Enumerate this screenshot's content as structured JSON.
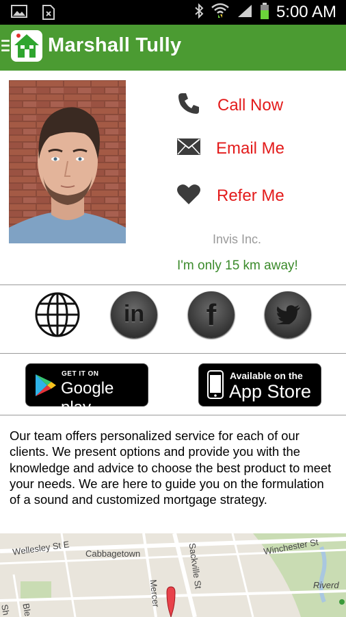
{
  "status_bar": {
    "time": "5:00 AM"
  },
  "app_bar": {
    "title": "Marshall Tully"
  },
  "contact_actions": [
    {
      "label": "Call Now",
      "icon": "phone-icon"
    },
    {
      "label": "Email Me",
      "icon": "envelope-icon"
    },
    {
      "label": "Refer Me",
      "icon": "heart-icon"
    }
  ],
  "company": "Invis Inc.",
  "distance_text": "I'm only 15 km away!",
  "social_links": [
    {
      "name": "website",
      "icon": "globe-icon"
    },
    {
      "name": "linkedin",
      "icon": "linkedin-icon",
      "glyph": "in"
    },
    {
      "name": "facebook",
      "icon": "facebook-icon",
      "glyph": "f"
    },
    {
      "name": "twitter",
      "icon": "twitter-icon"
    }
  ],
  "store_badges": {
    "google": {
      "small": "GET IT ON",
      "big": "Google play"
    },
    "apple": {
      "small": "Available on the",
      "big": "App Store"
    }
  },
  "about_text": "Our team offers personalized service for each of our clients. We present options and provide you with the knowledge and advice to choose the best product to meet your needs.  We are here to guide you on the formulation of a sound and customized mortgage strategy.",
  "map": {
    "labels": [
      "Wellesley St E",
      "Cabbagetown",
      "Sackville St",
      "Winchester St",
      "Riverd",
      "Mercer",
      "Sh",
      "Ble"
    ]
  },
  "colors": {
    "app_bar": "#4b9b32",
    "action_text": "#e31b1b",
    "distance_text": "#3a8a2a",
    "company_text": "#9a9a9a"
  }
}
